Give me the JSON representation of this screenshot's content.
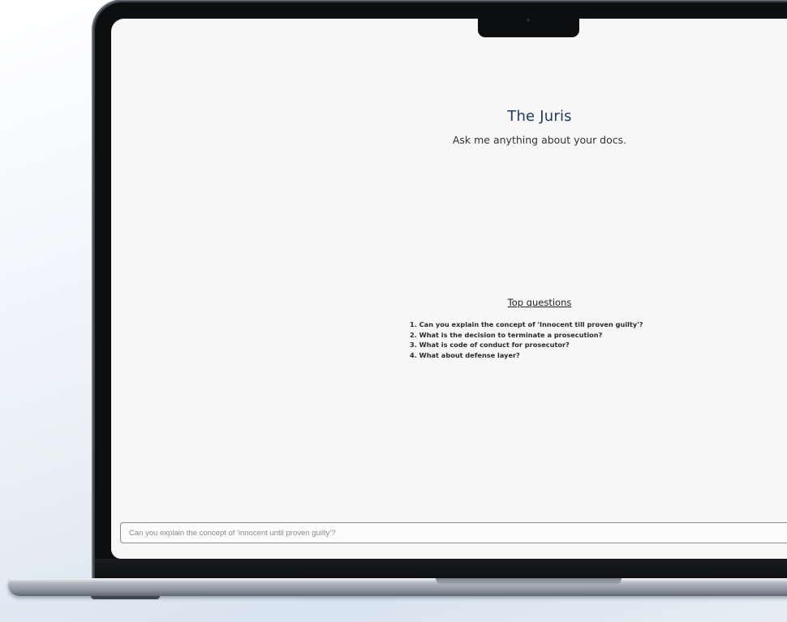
{
  "app": {
    "title": "The Juris",
    "subtitle": "Ask me anything about your docs."
  },
  "top_questions": {
    "heading": "Top questions",
    "items": [
      "1. Can you explain the concept of 'Innocent till proven guilty'?",
      "2. What is the decision to terminate a prosecution?",
      "3. What is code of conduct for prosecutor?",
      "4. What about defense layer?"
    ]
  },
  "chat": {
    "input_value": "",
    "placeholder": "Can you explain the concept of 'innocent until proven guilty'?"
  },
  "colors": {
    "title": "#23395d",
    "screen_background": "#f7f7f7",
    "bezel": "#0d0e10"
  }
}
